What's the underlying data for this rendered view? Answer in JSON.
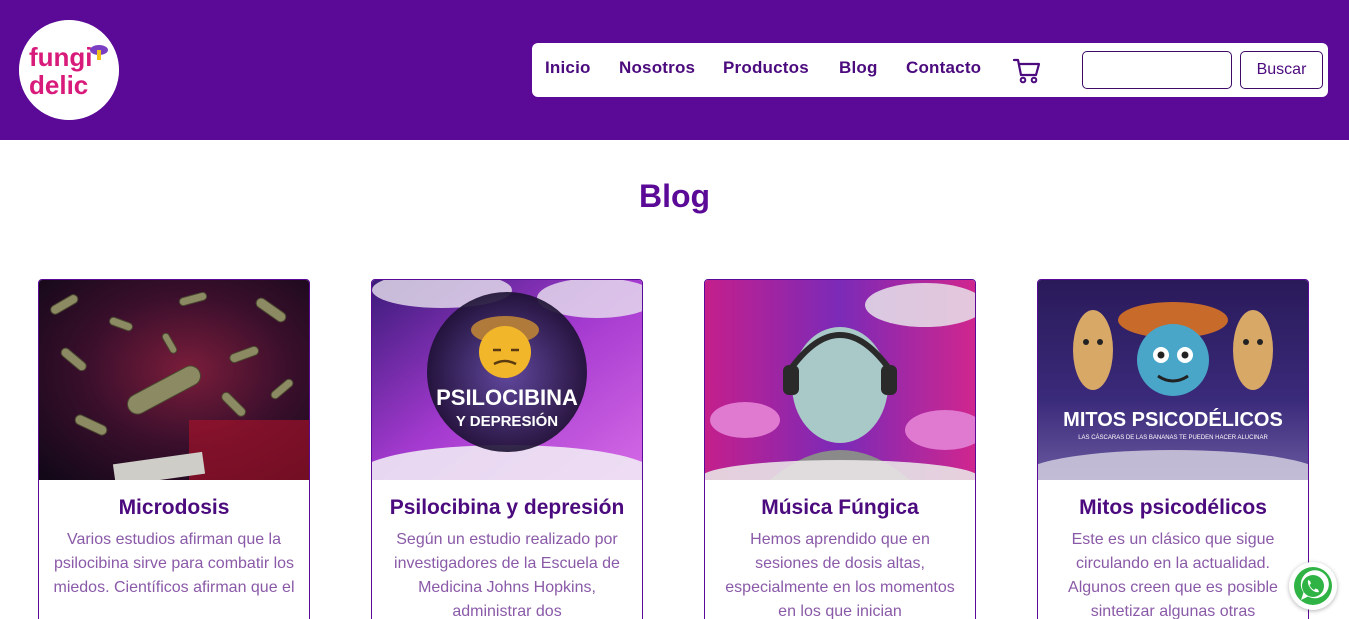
{
  "brand": {
    "logo_line1": "fungi",
    "logo_line2": "delic"
  },
  "nav": {
    "items": [
      {
        "label": "Inicio"
      },
      {
        "label": "Nosotros"
      },
      {
        "label": "Productos"
      },
      {
        "label": "Blog"
      },
      {
        "label": "Contacto"
      }
    ],
    "cart_icon": "shopping-cart-icon",
    "search": {
      "value": "",
      "placeholder": "",
      "button_label": "Buscar"
    }
  },
  "main": {
    "title": "Blog",
    "posts": [
      {
        "title": "Microdosis",
        "excerpt": "Varios estudios afirman que la psilocibina sirve para combatir los miedos. Científicos afirman que el",
        "image_text": ""
      },
      {
        "title": "Psilocibina y depresión",
        "excerpt": "Según un estudio realizado por investigadores de la Escuela de Medicina Johns Hopkins, administrar dos",
        "image_text": "PSILOCIBINA",
        "image_subtext": "Y DEPRESIÓN"
      },
      {
        "title": "Música Fúngica",
        "excerpt": "Hemos aprendido que en sesiones de dosis altas, especialmente en los momentos en los que inician",
        "image_text": ""
      },
      {
        "title": "Mitos psicodélicos",
        "excerpt": "Este es un clásico que sigue circulando en la actualidad. Algunos creen que es posible sintetizar algunas otras",
        "image_text": "MITOS PSICODÉLICOS",
        "image_subtext": "LAS CÁSCARAS DE LAS BANANAS TE PUEDEN HACER ALUCINAR"
      }
    ]
  },
  "floating": {
    "whatsapp_icon": "whatsapp-icon"
  },
  "colors": {
    "header_bg": "#5b0a98",
    "accent": "#4b0a7d",
    "text_muted": "#8a5aa8"
  }
}
